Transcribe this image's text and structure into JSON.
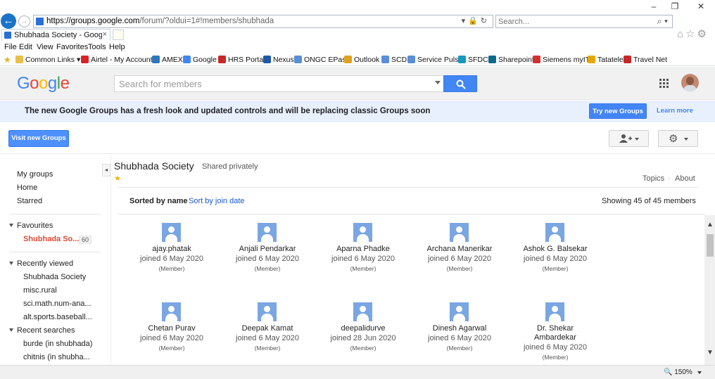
{
  "browser": {
    "url": "https://groups.google.com/forum/?oldui=1#!members/shubhada",
    "url_domain": "https://groups.google.com",
    "url_rest": "/forum/?oldui=1#!members/shubhada",
    "search_placeholder": "Search...",
    "tab_title": "Shubhada Society - Google ...",
    "menu": [
      "File",
      "Edit",
      "View",
      "Favorites",
      "Tools",
      "Help"
    ],
    "favorites": [
      {
        "label": "Common Links ▾",
        "color": "#e8c04a"
      },
      {
        "label": "Airtel - My Account",
        "color": "#d8232a"
      },
      {
        "label": "AMEX",
        "color": "#2e77bc"
      },
      {
        "label": "Google",
        "color": "#4285f4"
      },
      {
        "label": "HRS Portal",
        "color": "#c62828"
      },
      {
        "label": "Nexus",
        "color": "#1e5aa8"
      },
      {
        "label": "ONGC EPass",
        "color": "#5a8fd8"
      },
      {
        "label": "Outlook",
        "color": "#e0a020"
      },
      {
        "label": "SCD",
        "color": "#5a8fd8"
      },
      {
        "label": "Service Pulse",
        "color": "#5a8fd8"
      },
      {
        "label": "SFDC",
        "color": "#1798c1"
      },
      {
        "label": "Sharepoint",
        "color": "#0b6a8a"
      },
      {
        "label": "Siemens myIT",
        "color": "#d32f2f"
      },
      {
        "label": "Tatatele",
        "color": "#e6a800"
      },
      {
        "label": "Travel Net",
        "color": "#c62828"
      }
    ],
    "zoom": "150%"
  },
  "header": {
    "search_placeholder": "Search for members"
  },
  "banner": {
    "text": "The new Google Groups has a fresh look and updated controls and will be replacing classic Groups soon",
    "try_button": "Try new Groups",
    "learn_more": "Learn more"
  },
  "toolbar": {
    "visit_button": "Visit new Groups"
  },
  "nav": {
    "top_links": [
      "My groups",
      "Home",
      "Starred"
    ],
    "favourites_label": "Favourites",
    "favourite_item": "Shubhada So...",
    "favourite_count": "60",
    "recently_viewed_label": "Recently viewed",
    "recently_viewed": [
      "Shubhada Society",
      "misc.rural",
      "sci.math.num-ana...",
      "alt.sports.baseball..."
    ],
    "recent_searches_label": "Recent searches",
    "recent_searches": [
      "burde (in shubhada)",
      "chitnis (in shubha..."
    ]
  },
  "group": {
    "title": "Shubhada Society",
    "visibility": "Shared privately",
    "topics_link": "Topics",
    "about_link": "About",
    "separator": "·"
  },
  "sort": {
    "by_name": "Sorted by name",
    "by_join": "Sort by join date",
    "showing": "Showing 45 of 45 members"
  },
  "members": [
    {
      "name": "ajay.phatak",
      "joined": "joined 6 May 2020",
      "role": "(Member)"
    },
    {
      "name": "Anjali Pendarkar",
      "joined": "joined 6 May 2020",
      "role": "(Member)"
    },
    {
      "name": "Aparna Phadke",
      "joined": "joined 6 May 2020",
      "role": "(Member)"
    },
    {
      "name": "Archana Manerikar",
      "joined": "joined 6 May 2020",
      "role": "(Member)"
    },
    {
      "name": "Ashok G. Balsekar",
      "joined": "joined 6 May 2020",
      "role": "(Member)"
    },
    {
      "name": "Chetan Purav",
      "joined": "joined 6 May 2020",
      "role": "(Member)"
    },
    {
      "name": "Deepak Kamat",
      "joined": "joined 6 May 2020",
      "role": "(Member)"
    },
    {
      "name": "deepalidurve",
      "joined": "joined 28 Jun 2020",
      "role": "(Member)"
    },
    {
      "name": "Dinesh Agarwal",
      "joined": "joined 6 May 2020",
      "role": "(Member)"
    },
    {
      "name": "Dr. Shekar Ambardekar",
      "joined": "joined 6 May 2020",
      "role": "(Member)"
    }
  ],
  "colors": {
    "accent": "#4285f4",
    "active_nav": "#dd4b39",
    "banner_bg": "#e8f0fe",
    "avatar_placeholder": "#7aa6e3"
  }
}
